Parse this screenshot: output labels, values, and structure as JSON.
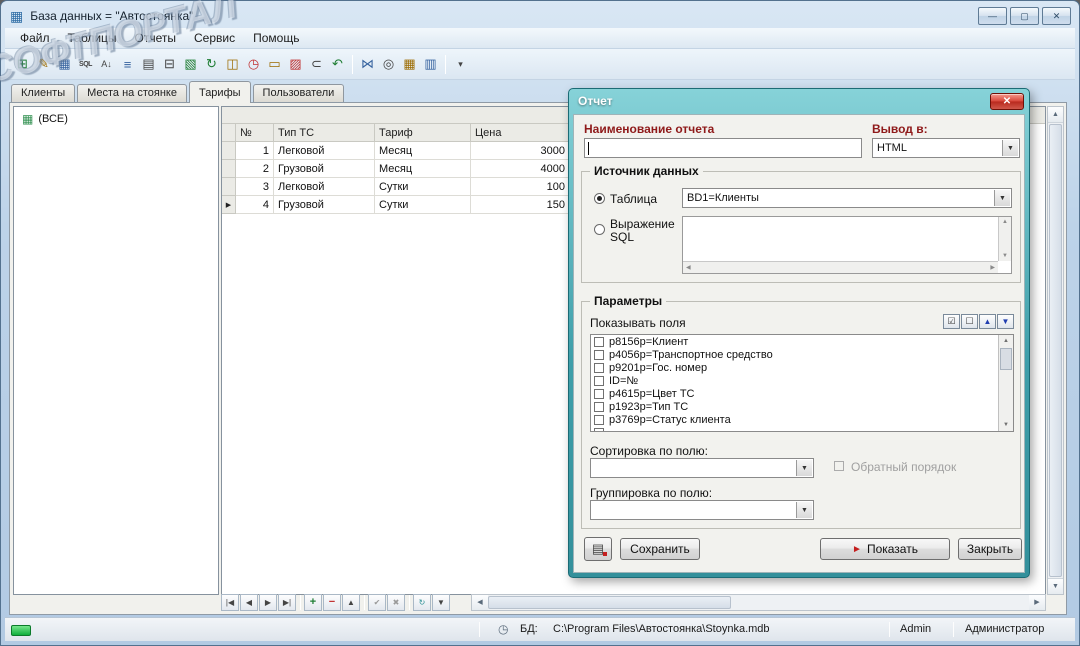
{
  "window": {
    "title": "База данных = \"Автостоянка\"",
    "watermark": "СОФТПОРТАЛ",
    "controls": {
      "minimize": "—",
      "maximize": "▢",
      "close": "✕"
    }
  },
  "icons": {
    "app": "▦",
    "up": "▲",
    "down": "▼",
    "left": "◀",
    "right": "▶",
    "clock": "◷",
    "table": "▦",
    "marker": "▶"
  },
  "menu": {
    "items": [
      "Файл",
      "Таблицы",
      "Отчеты",
      "Сервис",
      "Помощь"
    ]
  },
  "toolbar": {
    "icons": [
      {
        "name": "add-record",
        "glyph": "⊞"
      },
      {
        "name": "edit-record",
        "glyph": "✎"
      },
      {
        "name": "table-view",
        "glyph": "▦"
      },
      {
        "name": "sql-query",
        "glyph": "SQL"
      },
      {
        "name": "sort",
        "glyph": "A↓"
      },
      {
        "name": "field-list",
        "glyph": "≡"
      },
      {
        "name": "document",
        "glyph": "▤"
      },
      {
        "name": "print",
        "glyph": "⊟"
      },
      {
        "name": "export",
        "glyph": "▧"
      },
      {
        "name": "refresh",
        "glyph": "↻"
      },
      {
        "name": "clipboard",
        "glyph": "◫"
      },
      {
        "name": "history",
        "glyph": "◷"
      },
      {
        "name": "payment",
        "glyph": "▭"
      },
      {
        "name": "delete-chart",
        "glyph": "▨"
      },
      {
        "name": "attachment",
        "glyph": "⊂"
      },
      {
        "name": "undo",
        "glyph": "↶"
      },
      {
        "name": "relations",
        "glyph": "⋈"
      },
      {
        "name": "find",
        "glyph": "◎"
      },
      {
        "name": "summary",
        "glyph": "▦"
      },
      {
        "name": "chart",
        "glyph": "▥"
      },
      {
        "name": "more",
        "glyph": "▾"
      }
    ]
  },
  "tabs": {
    "items": [
      "Клиенты",
      "Места на стоянке",
      "Тарифы",
      "Пользователи"
    ],
    "active": "Тарифы"
  },
  "tree": {
    "root": "(ВСЕ)"
  },
  "grid": {
    "columns": [
      "№",
      "Тип ТС",
      "Тариф",
      "Цена"
    ],
    "rows": [
      [
        "1",
        "Легковой",
        "Месяц",
        "3000"
      ],
      [
        "2",
        "Грузовой",
        "Месяц",
        "4000"
      ],
      [
        "3",
        "Легковой",
        "Сутки",
        "100"
      ],
      [
        "4",
        "Грузовой",
        "Сутки",
        "150"
      ]
    ],
    "selected_row": 4
  },
  "recordnav": {
    "buttons": [
      {
        "name": "first-record",
        "glyph": "|◀"
      },
      {
        "name": "prev-record",
        "glyph": "◀"
      },
      {
        "name": "next-record",
        "glyph": "▶"
      },
      {
        "name": "last-record",
        "glyph": "▶|"
      },
      {
        "name": "add-record",
        "glyph": "+"
      },
      {
        "name": "delete-record",
        "glyph": "−"
      },
      {
        "name": "edit-record",
        "glyph": "▲"
      },
      {
        "name": "post-edit",
        "glyph": "✔"
      },
      {
        "name": "cancel-edit",
        "glyph": "✖"
      },
      {
        "name": "refresh",
        "glyph": "↻"
      },
      {
        "name": "filter",
        "glyph": "▼"
      }
    ]
  },
  "dialog": {
    "title": "Отчет",
    "name_label": "Наименование отчета",
    "name_value": "",
    "output_label": "Вывод в:",
    "output_value": "HTML",
    "source_legend": "Источник данных",
    "table_radio_label": "Таблица",
    "table_combo_value": "BD1=Клиенты",
    "sql_radio_label": "Выражение SQL",
    "sql_value": "",
    "params_legend": "Параметры",
    "fields_label": "Показывать поля",
    "fields": [
      "p8156p=Клиент",
      "p4056p=Транспортное средство",
      "p9201p=Гос. номер",
      "ID=№",
      "p4615p=Цвет ТС",
      "p1923p=Тип ТС",
      "p3769p=Статус клиента",
      ""
    ],
    "tools": {
      "check_all": "☑",
      "uncheck_all": "☐",
      "move_up": "▲",
      "move_down": "▼"
    },
    "sort_label": "Сортировка по полю:",
    "reverse_label": "Обратный порядок",
    "group_label": "Группировка по полю:",
    "save_button": "Сохранить",
    "show_button": "Показать",
    "show_icon": "►",
    "report_icon": "▤",
    "close_button": "Закрыть"
  },
  "statusbar": {
    "db_label": "БД:",
    "db_path": "C:\\Program Files\\Автостоянка\\Stoynka.mdb",
    "user": "Admin",
    "role": "Администратор"
  }
}
